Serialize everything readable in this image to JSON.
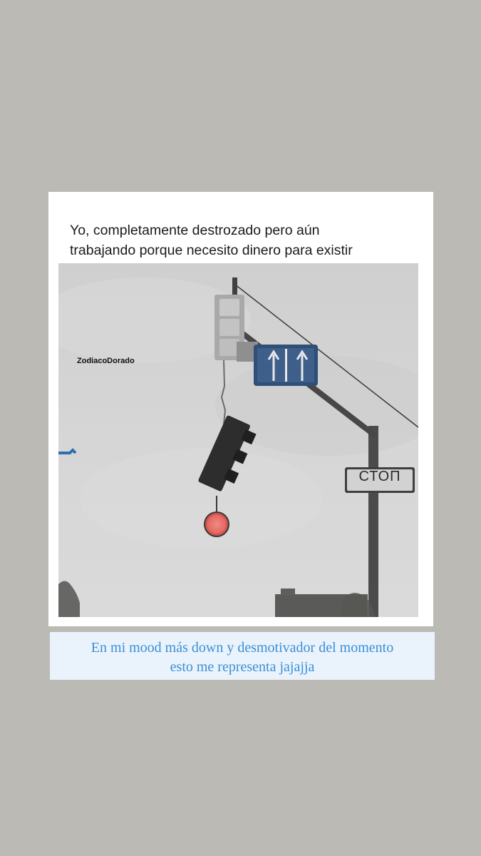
{
  "meme": {
    "caption_line1": "Yo, completamente destrozado pero aún",
    "caption_line2": "trabajando porque necesito dinero para existir",
    "watermark": "ZodiacoDorado",
    "stop_sign": "СТОП"
  },
  "story_caption": {
    "line1": "En mi mood más down y desmotivador del momento",
    "line2": "esto me representa jajajja"
  },
  "colors": {
    "background": "#bbbab5",
    "card": "#ffffff",
    "sky": "#d4d4d4",
    "caption_box": "#eaf3fc",
    "caption_text": "#3a8fd6",
    "red_light": "#e56a63",
    "street_sign_blue": "#3e5f8a"
  }
}
